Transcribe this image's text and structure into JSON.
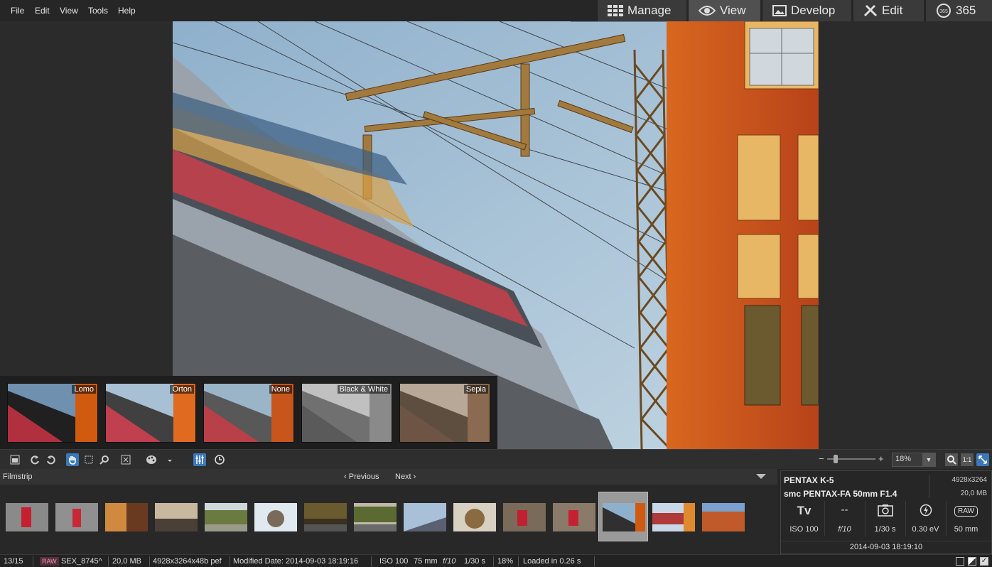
{
  "menu": {
    "file": "File",
    "edit": "Edit",
    "view": "View",
    "tools": "Tools",
    "help": "Help"
  },
  "modes": [
    {
      "label": "Manage",
      "icon": "grid-icon"
    },
    {
      "label": "View",
      "icon": "eye-icon",
      "active": true
    },
    {
      "label": "Develop",
      "icon": "image-icon"
    },
    {
      "label": "Edit",
      "icon": "tools-icon"
    },
    {
      "label": "365",
      "icon": "365-icon"
    }
  ],
  "presets": [
    {
      "label": "Lomo"
    },
    {
      "label": "Orton"
    },
    {
      "label": "None"
    },
    {
      "label": "Black & White"
    },
    {
      "label": "Sepia"
    }
  ],
  "zoom": {
    "value": "18%",
    "minus": "−",
    "plus": "+",
    "one_to_one": "1:1",
    "level": 0.18
  },
  "filmstrip": {
    "label": "Filmstrip",
    "previous": "Previous",
    "next": "Next",
    "selected_index": 12,
    "count": 15
  },
  "info": {
    "camera": "PENTAX K-5",
    "lens": "smc PENTAX-FA 50mm F1.4",
    "resolution": "4928x3264",
    "size": "20,0 MB",
    "mode": "Tv",
    "metering": "--",
    "iso": "ISO 100",
    "aperture": "f/10",
    "shutter": "1/30 s",
    "exposure": "0.30 eV",
    "focal": "50 mm",
    "raw": "RAW",
    "date": "2014-09-03 18:19:10"
  },
  "status": {
    "position": "13/15",
    "raw": "RAW",
    "filename": "SEX_8745^",
    "filesize": "20,0 MB",
    "dims": "4928x3264x48b pef",
    "modified": "Modified Date: 2014-09-03 18:19:16",
    "iso": "ISO 100",
    "focal": "75 mm",
    "aperture": "f/10",
    "shutter": "1/30 s",
    "zoom": "18%",
    "loaded": "Loaded in 0.26 s"
  },
  "colors": {
    "accent": "#3c78b8",
    "brick": "#c4521e",
    "sky": "#a9c4dc"
  }
}
